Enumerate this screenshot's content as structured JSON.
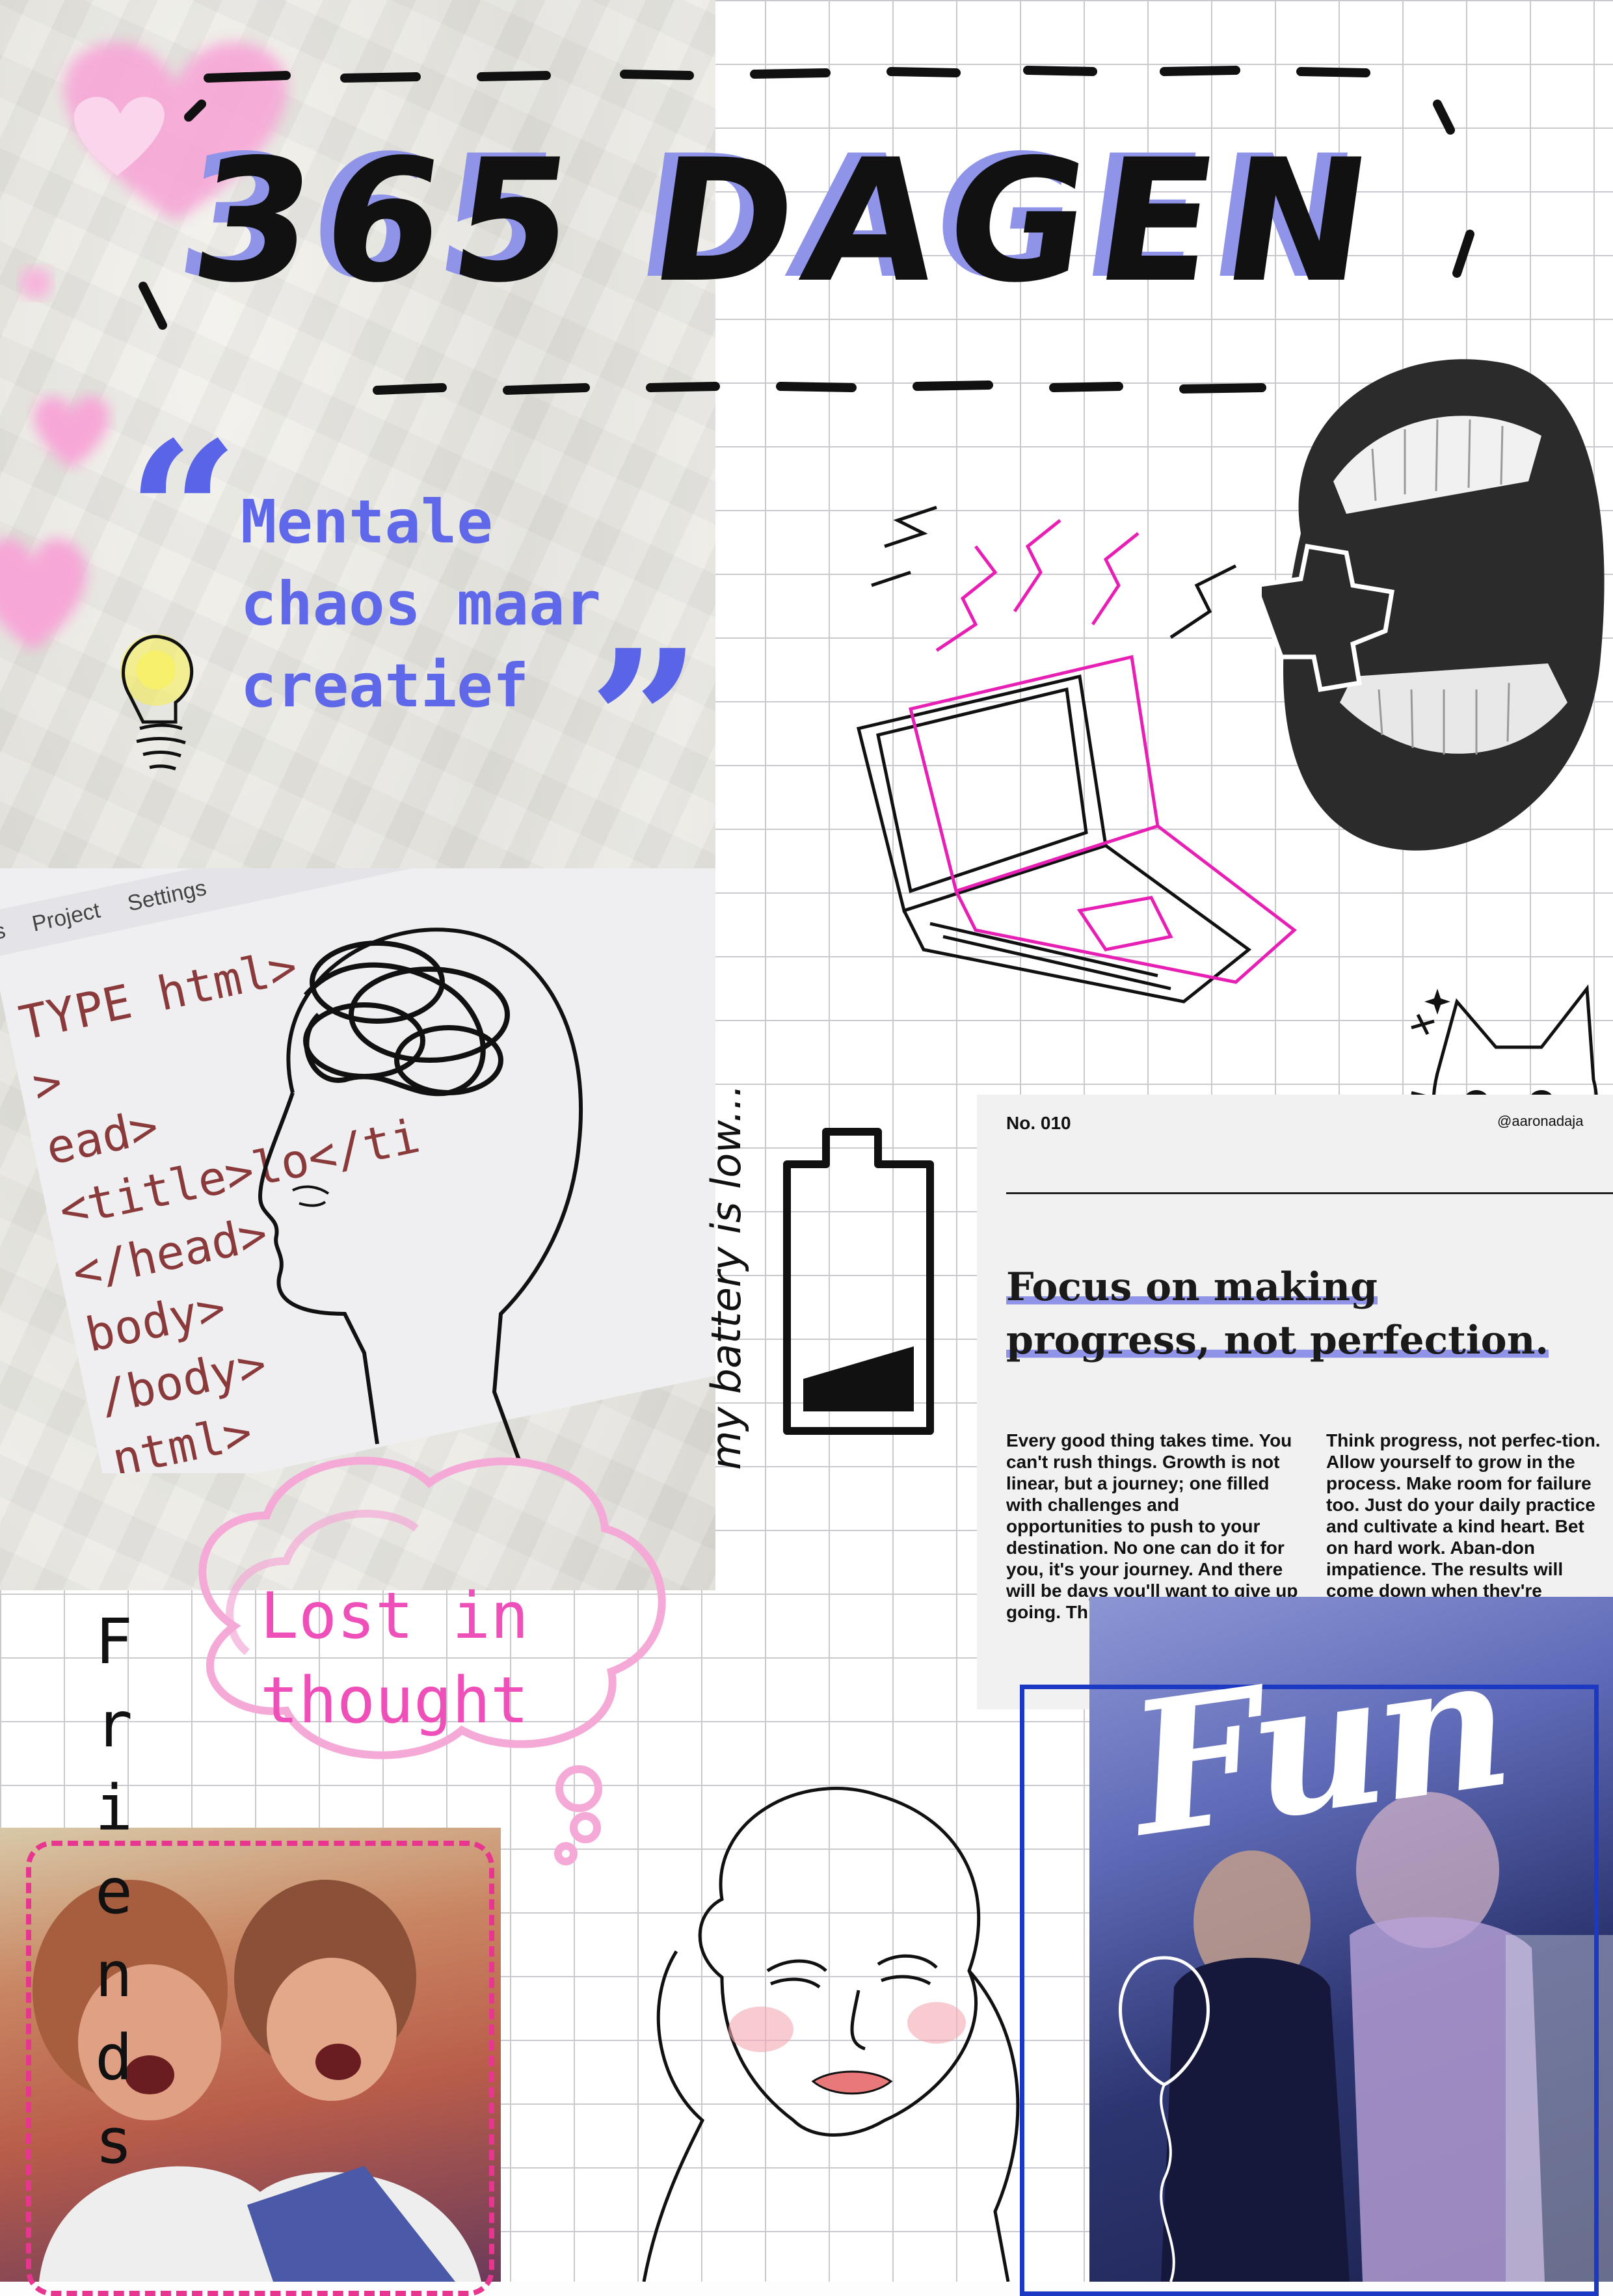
{
  "title": "365 DAGEN",
  "quote": {
    "open_mark": "“",
    "close_mark": "”",
    "lines": [
      "Mentale",
      "chaos maar",
      "creatief"
    ]
  },
  "code_screenshot": {
    "menu": [
      "s",
      "Project",
      "Settings"
    ],
    "lines": [
      "TYPE html>",
      ">",
      "ead>",
      "<title>lo</ti",
      "</head>",
      "body>",
      "/body>",
      "ntml>"
    ]
  },
  "battery_label": "my battery is low...",
  "thought_bubble_text": [
    "Lost in",
    "thought"
  ],
  "friends_label": [
    "F",
    "r",
    "i",
    "e",
    "n",
    "d",
    "s"
  ],
  "magazine": {
    "issue": "No. 010",
    "handle": "@aaronadaja",
    "headline_lines": [
      "Focus on making",
      "progress, not perfection."
    ],
    "column1": "Every good thing takes time. You can't rush things. Growth is not linear, but a journey; one filled with challenges and opportunities to push to your destination. No one can do it for you, it's your journey. And there will be days you'll want to give up going. Th to get the embrace",
    "column2": "Think progress, not perfec-tion. Allow yourself to grow in the process. Make room for failure too. Just do your daily practice and cultivate a kind heart. Bet on hard work. Aban-don impatience. The results will come down when they're"
  },
  "fun_label": "Fun",
  "colors": {
    "accent_blue": "#5f68e8",
    "accent_pink": "#ee4fb8",
    "lavender": "#8f94e8",
    "frame_blue": "#1c39c4"
  },
  "icons": [
    "heart-icon",
    "lightbulb-icon",
    "brain-sketch-icon",
    "laptop-sketch-icon",
    "mouth-cutout-icon",
    "puzzle-piece-icon",
    "cat-doodle-icon",
    "battery-low-icon",
    "balloon-icon",
    "face-sketch-icon",
    "sparkle-star-icon"
  ]
}
